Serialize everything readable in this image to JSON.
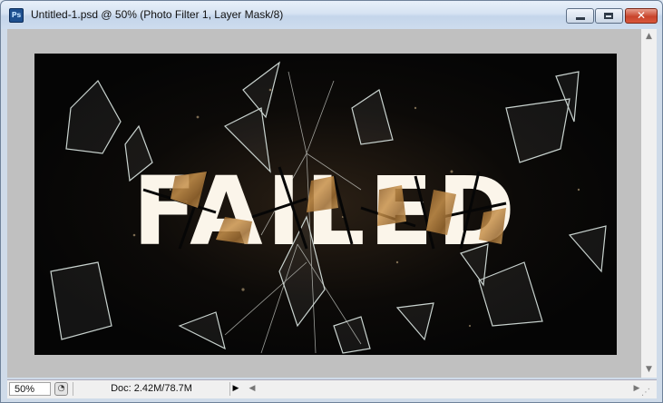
{
  "window": {
    "app_icon_label": "Ps",
    "title": "Untitled-1.psd @ 50% (Photo Filter 1, Layer Mask/8)",
    "close_label": "✕"
  },
  "artwork": {
    "headline_text": "FAILED",
    "background_color": "#060606",
    "text_fill_color": "#fbf5ea",
    "texture_color": "#b07a3a",
    "glass_color": "#c9d3cf"
  },
  "statusbar": {
    "zoom_value": "50%",
    "doc_info": "Doc: 2.42M/78.7M"
  },
  "icons": [
    "photoshop-app-icon",
    "minimize-icon",
    "maximize-icon",
    "close-icon",
    "zoom-preview-icon",
    "info-menu-arrow-icon",
    "scroll-arrow-icons",
    "resize-grip-icon"
  ]
}
